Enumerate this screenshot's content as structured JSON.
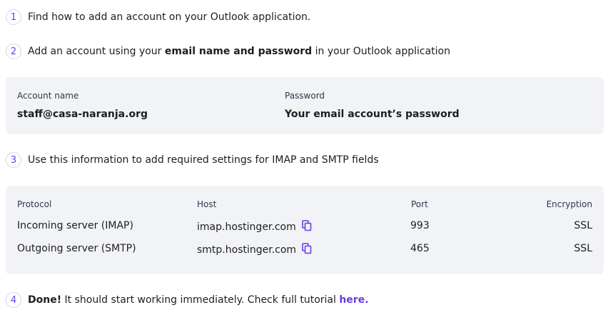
{
  "steps": {
    "s1": {
      "num": "1",
      "text": "Find how to add an account on your Outlook application."
    },
    "s2": {
      "num": "2",
      "pre": "Add an account using your ",
      "bold": "email name and password",
      "post": " in your Outlook application"
    },
    "s3": {
      "num": "3",
      "text": "Use this information to add required settings for IMAP and SMTP fields"
    },
    "s4": {
      "num": "4",
      "bold": "Done!",
      "mid": " It should start working immediately. Check full tutorial ",
      "link": "here."
    }
  },
  "account": {
    "name_label": "Account name",
    "name_value": "staff@casa-naranja.org",
    "password_label": "Password",
    "password_value": "Your email account’s password"
  },
  "servers": {
    "headers": {
      "protocol": "Protocol",
      "host": "Host",
      "port": "Port",
      "encryption": "Encryption"
    },
    "rows": [
      {
        "protocol": "Incoming server (IMAP)",
        "host": "imap.hostinger.com",
        "port": "993",
        "encryption": "SSL"
      },
      {
        "protocol": "Outgoing server (SMTP)",
        "host": "smtp.hostinger.com",
        "port": "465",
        "encryption": "SSL"
      }
    ]
  },
  "colors": {
    "accent": "#673de6",
    "panel_bg": "#f2f3f6",
    "text": "#1d1e20"
  },
  "icons": {
    "copy": "copy-icon"
  }
}
